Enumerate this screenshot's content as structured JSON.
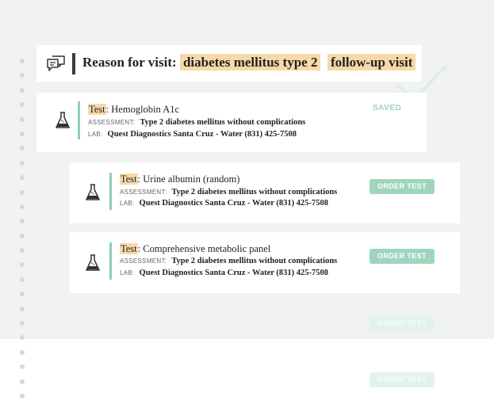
{
  "reason": {
    "label": "Reason for visit",
    "colon": ":",
    "tag1": "diabetes mellitus type 2",
    "tag2": "follow-up visit"
  },
  "tests": [
    {
      "key": "Test",
      "name": "Hemoglobin A1c",
      "assessment_label": "ASSESSMENT:",
      "assessment": "Type 2 diabetes mellitus without complications",
      "lab_label": "LAB:",
      "lab": "Quest Diagnostics Santa Cruz - Water (831) 425-7508",
      "status": "SAVED"
    },
    {
      "key": "Test",
      "name": "Urine albumin (random)",
      "assessment_label": "ASSESSMENT:",
      "assessment": "Type 2 diabetes mellitus without complications",
      "lab_label": "LAB:",
      "lab": "Quest Diagnostics Santa Cruz - Water (831) 425-7508",
      "button": "ORDER TEST"
    },
    {
      "key": "Test",
      "name": "Comprehensive metabolic panel",
      "assessment_label": "ASSESSMENT:",
      "assessment": "Type 2 diabetes mellitus without complications",
      "lab_label": "LAB:",
      "lab": "Quest Diagnostics Santa Cruz - Water (831) 425-7508",
      "button": "ORDER TEST"
    }
  ],
  "faded_buttons": [
    "ORDER TEST",
    "ORDER TEST"
  ],
  "colors": {
    "accent_green": "#9fd5bd",
    "highlight": "#f7d9a8",
    "panel": "#f1f2f3"
  }
}
